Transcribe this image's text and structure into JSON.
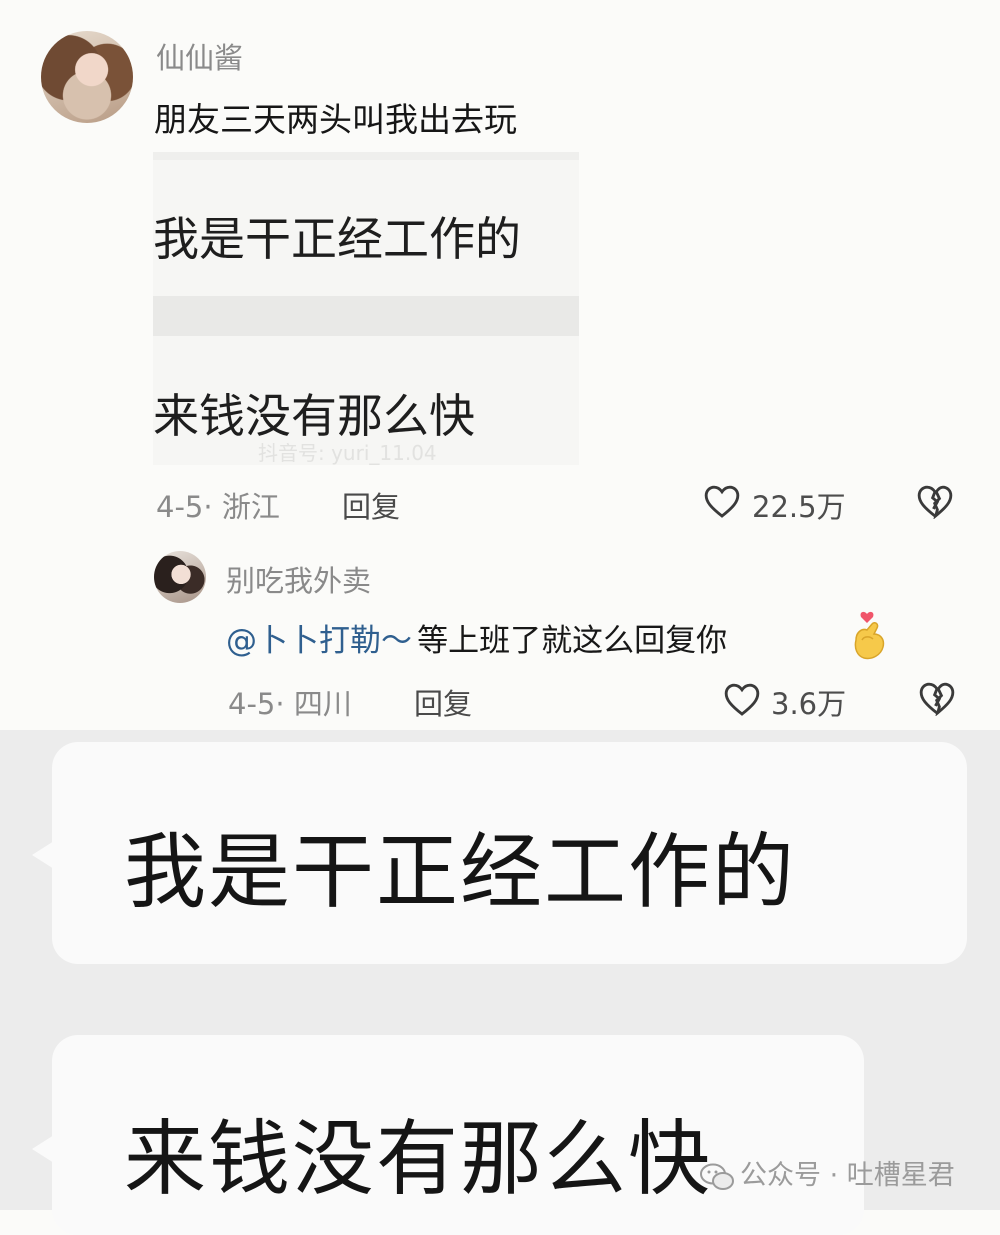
{
  "comment": {
    "username": "仙仙酱",
    "text": "朋友三天两头叫我出去玩",
    "embedded_lines": [
      "我是干正经工作的",
      "来钱没有那么快"
    ],
    "embedded_watermark": "抖音号: yuri_11.04",
    "date": "4-5",
    "location": "浙江",
    "reply_label": "回复",
    "like_count": "22.5万"
  },
  "reply": {
    "username": "别吃我外卖",
    "mention": "@卜卜打勒～",
    "text": "等上班了就这么回复你",
    "date": "4-5",
    "location": "四川",
    "reply_label": "回复",
    "like_count": "3.6万"
  },
  "chat_bubbles": [
    "我是干正经工作的",
    "来钱没有那么快"
  ],
  "watermark": {
    "platform": "公众号",
    "separator": "·",
    "account": "吐槽星君"
  },
  "colors": {
    "background": "#fbfbf9",
    "mention": "#2f5f8f",
    "chat_background": "#ececec",
    "bubble": "#fafafa"
  },
  "icons": [
    "heart-outline-icon",
    "broken-heart-icon",
    "finger-heart-emoji",
    "wechat-icon"
  ]
}
